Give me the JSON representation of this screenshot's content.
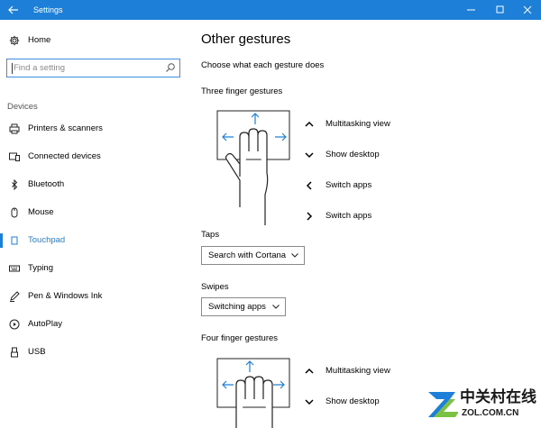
{
  "window": {
    "title": "Settings"
  },
  "sidebar": {
    "home_label": "Home",
    "search_placeholder": "Find a setting",
    "section_label": "Devices",
    "items": [
      {
        "label": "Printers & scanners",
        "icon": "printer-icon"
      },
      {
        "label": "Connected devices",
        "icon": "connected-devices-icon"
      },
      {
        "label": "Bluetooth",
        "icon": "bluetooth-icon"
      },
      {
        "label": "Mouse",
        "icon": "mouse-icon"
      },
      {
        "label": "Touchpad",
        "icon": "touchpad-icon",
        "active": true
      },
      {
        "label": "Typing",
        "icon": "keyboard-icon"
      },
      {
        "label": "Pen & Windows Ink",
        "icon": "pen-icon"
      },
      {
        "label": "AutoPlay",
        "icon": "autoplay-icon"
      },
      {
        "label": "USB",
        "icon": "usb-icon"
      }
    ]
  },
  "main": {
    "title": "Other gestures",
    "subtitle": "Choose what each gesture does",
    "three_finger": {
      "heading": "Three finger gestures",
      "gestures": [
        {
          "direction": "up",
          "action": "Multitasking view"
        },
        {
          "direction": "down",
          "action": "Show desktop"
        },
        {
          "direction": "left",
          "action": "Switch apps"
        },
        {
          "direction": "right",
          "action": "Switch apps"
        }
      ],
      "taps_label": "Taps",
      "taps_value": "Search with Cortana",
      "swipes_label": "Swipes",
      "swipes_value": "Switching apps"
    },
    "four_finger": {
      "heading": "Four finger gestures",
      "gestures": [
        {
          "direction": "up",
          "action": "Multitasking view"
        },
        {
          "direction": "down",
          "action": "Show desktop"
        }
      ]
    }
  },
  "watermark": {
    "brand_cn": "中关村在线",
    "url": "ZOL.COM.CN"
  },
  "colors": {
    "accent": "#1e7fd8",
    "text": "#000000",
    "muted": "#8a8a8a"
  }
}
